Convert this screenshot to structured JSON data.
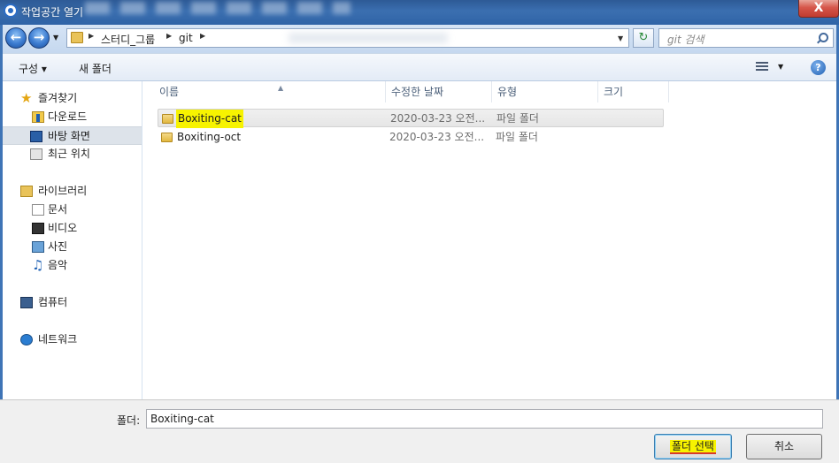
{
  "window": {
    "title": "작업공간 열기",
    "close_glyph": "X"
  },
  "address": {
    "crumbs": [
      "스터디_그룹",
      "git"
    ],
    "search_placeholder": "git 검색"
  },
  "toolbar": {
    "organize_label": "구성 ▾",
    "new_folder_label": "새 폴더",
    "help_glyph": "?"
  },
  "nav_pane": {
    "favorites_label": "즐겨찾기",
    "favorites": [
      "다운로드",
      "바탕 화면",
      "최근 위치"
    ],
    "libraries_label": "라이브러리",
    "libraries": [
      "문서",
      "비디오",
      "사진",
      "음악"
    ],
    "computer_label": "컴퓨터",
    "network_label": "네트워크",
    "selected": "바탕 화면"
  },
  "columns": [
    "이름",
    "수정한 날짜",
    "유형",
    "크기"
  ],
  "files": [
    {
      "name": "Boxiting-cat",
      "date": "2020-03-23 오전...",
      "type": "파일 폴더",
      "size": ""
    },
    {
      "name": "Boxiting-oct",
      "date": "2020-03-23 오전...",
      "type": "파일 폴더",
      "size": ""
    }
  ],
  "footer": {
    "folder_label": "폴더:",
    "folder_value": "Boxiting-cat",
    "select_folder_label": "폴더 선택",
    "cancel_label": "취소"
  },
  "colors": {
    "titlebar": "#2f63a6",
    "highlight": "#f7f300",
    "underline": "#d83a2a"
  }
}
